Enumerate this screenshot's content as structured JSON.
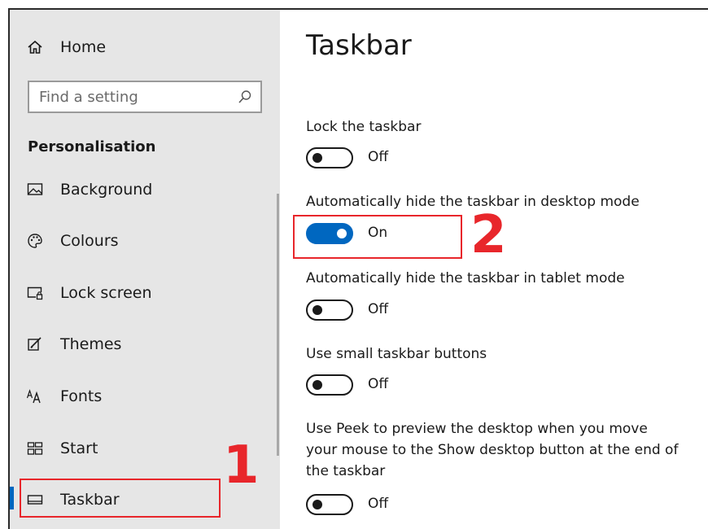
{
  "sidebar": {
    "home_label": "Home",
    "search_placeholder": "Find a setting",
    "section_title": "Personalisation",
    "items": [
      {
        "label": "Background",
        "icon": "image-icon"
      },
      {
        "label": "Colours",
        "icon": "palette-icon"
      },
      {
        "label": "Lock screen",
        "icon": "lock-screen-icon"
      },
      {
        "label": "Themes",
        "icon": "themes-icon"
      },
      {
        "label": "Fonts",
        "icon": "fonts-icon"
      },
      {
        "label": "Start",
        "icon": "start-icon"
      },
      {
        "label": "Taskbar",
        "icon": "taskbar-icon",
        "selected": true
      }
    ]
  },
  "main": {
    "title": "Taskbar",
    "settings": [
      {
        "label": "Lock the taskbar",
        "state": "Off",
        "on": false
      },
      {
        "label": "Automatically hide the taskbar in desktop mode",
        "state": "On",
        "on": true
      },
      {
        "label": "Automatically hide the taskbar in tablet mode",
        "state": "Off",
        "on": false
      },
      {
        "label": "Use small taskbar buttons",
        "state": "Off",
        "on": false
      },
      {
        "label": "Use Peek to preview the desktop when you move your mouse to the Show desktop button at the end of the taskbar",
        "state": "Off",
        "on": false
      }
    ]
  },
  "annotations": {
    "step1": "1",
    "step2": "2",
    "color": "#e8262b"
  },
  "colors": {
    "accent": "#0067c0",
    "sidebar_bg": "#e6e6e6"
  }
}
